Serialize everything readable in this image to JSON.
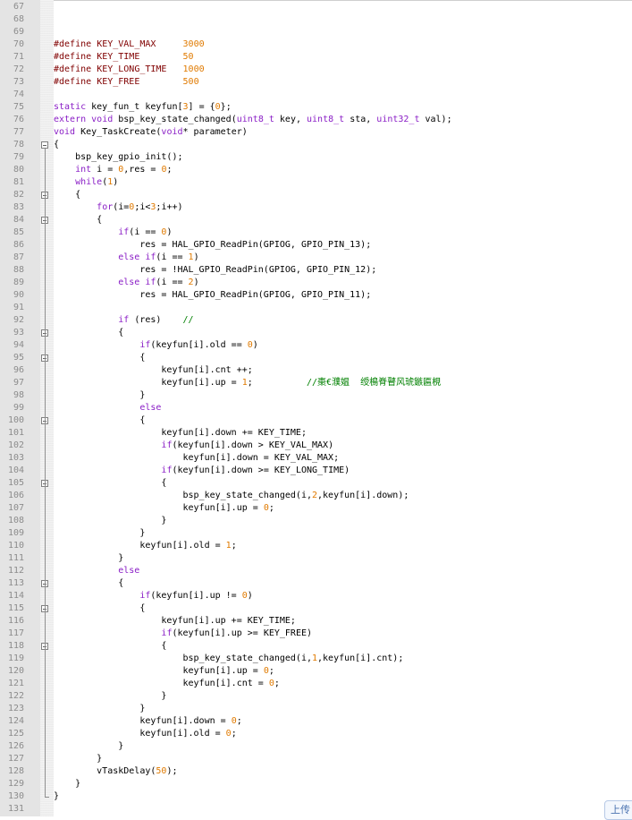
{
  "editor": {
    "lines": [
      {
        "num": "67",
        "code": ""
      },
      {
        "num": "68",
        "code": ""
      },
      {
        "num": "69",
        "code": ""
      },
      {
        "num": "70",
        "code": "#define KEY_VAL_MAX     3000"
      },
      {
        "num": "71",
        "code": "#define KEY_TIME        50"
      },
      {
        "num": "72",
        "code": "#define KEY_LONG_TIME   1000"
      },
      {
        "num": "73",
        "code": "#define KEY_FREE        500"
      },
      {
        "num": "74",
        "code": ""
      },
      {
        "num": "75",
        "code": "static key_fun_t keyfun[3] = {0};"
      },
      {
        "num": "76",
        "code": "extern void bsp_key_state_changed(uint8_t key, uint8_t sta, uint32_t val);"
      },
      {
        "num": "77",
        "code": "void Key_TaskCreate(void* parameter)"
      },
      {
        "num": "78",
        "code": "{"
      },
      {
        "num": "79",
        "code": "    bsp_key_gpio_init();"
      },
      {
        "num": "80",
        "code": "    int i = 0,res = 0;"
      },
      {
        "num": "81",
        "code": "    while(1)"
      },
      {
        "num": "82",
        "code": "    {"
      },
      {
        "num": "83",
        "code": "        for(i=0;i<3;i++)"
      },
      {
        "num": "84",
        "code": "        {"
      },
      {
        "num": "85",
        "code": "            if(i == 0)"
      },
      {
        "num": "86",
        "code": "                res = HAL_GPIO_ReadPin(GPIOG, GPIO_PIN_13);"
      },
      {
        "num": "87",
        "code": "            else if(i == 1)"
      },
      {
        "num": "88",
        "code": "                res = !HAL_GPIO_ReadPin(GPIOG, GPIO_PIN_12);"
      },
      {
        "num": "89",
        "code": "            else if(i == 2)"
      },
      {
        "num": "90",
        "code": "                res = HAL_GPIO_ReadPin(GPIOG, GPIO_PIN_11);"
      },
      {
        "num": "91",
        "code": ""
      },
      {
        "num": "92",
        "code": "            if (res)    //"
      },
      {
        "num": "93",
        "code": "            {"
      },
      {
        "num": "94",
        "code": "                if(keyfun[i].old == 0)"
      },
      {
        "num": "95",
        "code": "                {"
      },
      {
        "num": "96",
        "code": "                    keyfun[i].cnt ++;"
      },
      {
        "num": "97",
        "code": "                    keyfun[i].up = 1;          //棗€濮媪  绶樢脊瞽风琥鏃匾梘"
      },
      {
        "num": "98",
        "code": "                }"
      },
      {
        "num": "99",
        "code": "                else"
      },
      {
        "num": "100",
        "code": "                {"
      },
      {
        "num": "101",
        "code": "                    keyfun[i].down += KEY_TIME;"
      },
      {
        "num": "102",
        "code": "                    if(keyfun[i].down > KEY_VAL_MAX)"
      },
      {
        "num": "103",
        "code": "                        keyfun[i].down = KEY_VAL_MAX;"
      },
      {
        "num": "104",
        "code": "                    if(keyfun[i].down >= KEY_LONG_TIME)"
      },
      {
        "num": "105",
        "code": "                    {"
      },
      {
        "num": "106",
        "code": "                        bsp_key_state_changed(i,2,keyfun[i].down);"
      },
      {
        "num": "107",
        "code": "                        keyfun[i].up = 0;"
      },
      {
        "num": "108",
        "code": "                    }"
      },
      {
        "num": "109",
        "code": "                }"
      },
      {
        "num": "110",
        "code": "                keyfun[i].old = 1;"
      },
      {
        "num": "111",
        "code": "            }"
      },
      {
        "num": "112",
        "code": "            else"
      },
      {
        "num": "113",
        "code": "            {"
      },
      {
        "num": "114",
        "code": "                if(keyfun[i].up != 0)"
      },
      {
        "num": "115",
        "code": "                {"
      },
      {
        "num": "116",
        "code": "                    keyfun[i].up += KEY_TIME;"
      },
      {
        "num": "117",
        "code": "                    if(keyfun[i].up >= KEY_FREE)"
      },
      {
        "num": "118",
        "code": "                    {"
      },
      {
        "num": "119",
        "code": "                        bsp_key_state_changed(i,1,keyfun[i].cnt);"
      },
      {
        "num": "120",
        "code": "                        keyfun[i].up = 0;"
      },
      {
        "num": "121",
        "code": "                        keyfun[i].cnt = 0;"
      },
      {
        "num": "122",
        "code": "                    }"
      },
      {
        "num": "123",
        "code": "                }"
      },
      {
        "num": "124",
        "code": "                keyfun[i].down = 0;"
      },
      {
        "num": "125",
        "code": "                keyfun[i].old = 0;"
      },
      {
        "num": "126",
        "code": "            }"
      },
      {
        "num": "127",
        "code": "        }"
      },
      {
        "num": "128",
        "code": "        vTaskDelay(50);"
      },
      {
        "num": "129",
        "code": "    }"
      },
      {
        "num": "130",
        "code": "}"
      },
      {
        "num": "131",
        "code": ""
      }
    ],
    "fold_markers": [
      "78",
      "82",
      "84",
      "93",
      "95",
      "100",
      "105",
      "113",
      "115",
      "118"
    ]
  },
  "upload_tab": {
    "label": "上传"
  },
  "colors": {
    "keyword": "#8a1ec6",
    "builtin_type": "#0000ff",
    "number": "#e07a00",
    "comment": "#008000",
    "line_number": "#8c8c8c",
    "gutter": "#e4e4e4"
  }
}
